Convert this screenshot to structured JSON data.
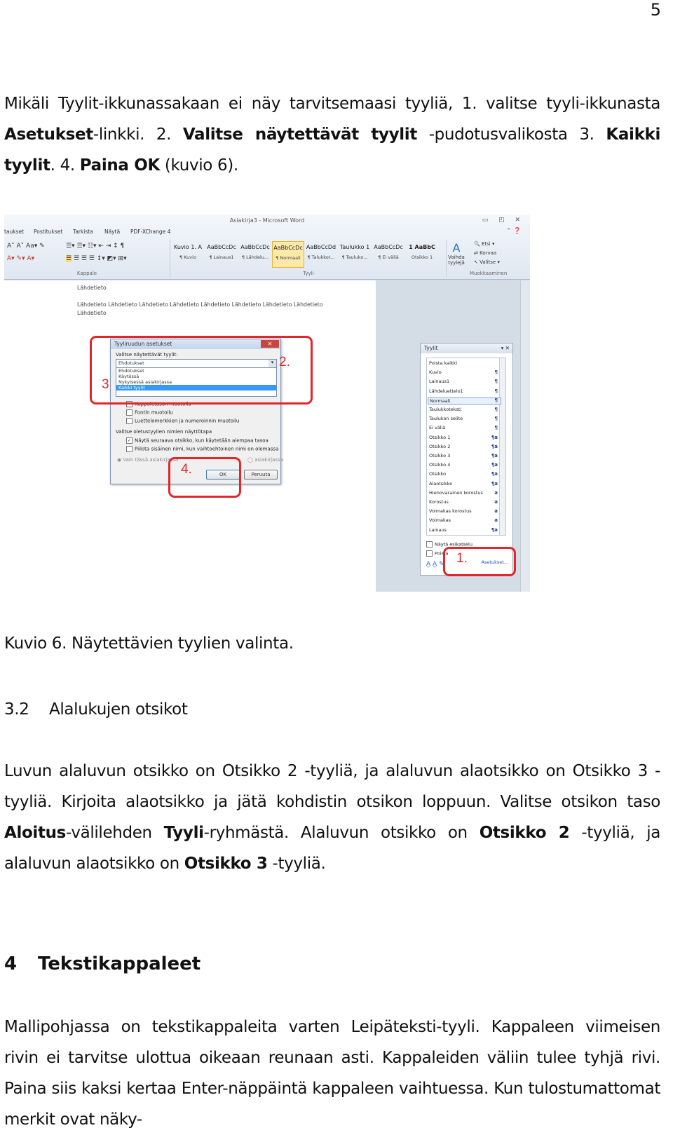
{
  "page_number": "5",
  "intro": {
    "t1": "Mikäli Tyylit-ikkunassakaan ei näy tarvitsemaasi tyyliä, 1. valitse tyyli-ikkunasta ",
    "b1": "Asetukset",
    "t2": "-linkki. 2. ",
    "b2": "Valitse näytettävät tyylit",
    "t3": " -pudotusvalikosta 3. ",
    "b3": "Kaikki tyylit",
    "t4": ". 4. ",
    "b4": "Paina OK",
    "t5": " (kuvio 6)."
  },
  "figure": {
    "window_title": "Asiakirja3 - Microsoft Word",
    "tabs": [
      "taukset",
      "Postitukset",
      "Tarkista",
      "Näytä",
      "PDF-XChange 4"
    ],
    "group_paragraph": "Kappale",
    "group_styles": "Tyyli",
    "group_editing": "Muokkaaminen",
    "style_gallery": [
      {
        "preview": "Kuvio 1. A",
        "name": "¶ Kuvio"
      },
      {
        "preview": "AaBbCcDc",
        "name": "¶ Lainaus1"
      },
      {
        "preview": "AaBbCcDc",
        "name": "¶ Lähdelu..."
      },
      {
        "preview": "AaBbCcDc",
        "name": "¶ Normaali"
      },
      {
        "preview": "AaBbCcDd",
        "name": "¶ Talukkot..."
      },
      {
        "preview": "Taulukko 1",
        "name": "¶ Taulukо..."
      },
      {
        "preview": "AaBbCcDc",
        "name": "¶ Ei väliä"
      },
      {
        "preview": "1 AaBbC",
        "name": "Otsikko 1"
      }
    ],
    "change_styles": "Vaihda tyylejä",
    "find": "Etsi",
    "replace": "Korvaa",
    "select": "Valitse",
    "doc_word": "Lähdetieto",
    "doc_line_1": "Lähdetieto Lähdetieto Lähdetieto Lähdetieto Lähdetieto Lähdetieto Lähdetieto Lähdetieto",
    "doc_line_2": "Lähdetieto",
    "dialog": {
      "title": "Tyyliruudun asetukset",
      "select_label": "Valitse näytettävät tyylit:",
      "combo_value": "Ehdotukset",
      "list": [
        "Ehdotukset",
        "Käytössä",
        "Nykyisessä asiakirjassa",
        "Kaikki tyylit"
      ],
      "opt_para": "Kappaletason muotoilu",
      "opt_font": "Fontin muotoilu",
      "opt_list": "Luettelomerkkien ja numeroinnin muotoilu",
      "names_label": "Valitse oletustyylien nimien näyttötapa",
      "opt_show_next": "Näytä seuraava otsikko, kun käytetään aiempaa tasoa",
      "opt_hide_builtin": "Piilota sisäinen nimi, kun vaihtoehtoinen nimi on olemassa",
      "radio_doc": "Vain tässä asiakirjassa",
      "radio_new": "asiakirjassa",
      "ok": "OK",
      "cancel": "Peruuta"
    },
    "pane": {
      "title": "Tyylit",
      "items": [
        {
          "name": "Poista kaikki",
          "mark": ""
        },
        {
          "name": "Kuvio",
          "mark": "¶"
        },
        {
          "name": "Lainaus1",
          "mark": "¶"
        },
        {
          "name": "Lähdeluettelo1",
          "mark": "¶"
        },
        {
          "name": "Normaali",
          "mark": "¶"
        },
        {
          "name": "Taulukkoteksti",
          "mark": "¶"
        },
        {
          "name": "Taulukon selite",
          "mark": "¶"
        },
        {
          "name": "Ei väliä",
          "mark": "¶"
        },
        {
          "name": "Otsikko 1",
          "mark": "¶a"
        },
        {
          "name": "Otsikko 2",
          "mark": "¶a"
        },
        {
          "name": "Otsikko 3",
          "mark": "¶a"
        },
        {
          "name": "Otsikko 4",
          "mark": "¶a"
        },
        {
          "name": "Otsikko",
          "mark": "¶a"
        },
        {
          "name": "Alaotsikko",
          "mark": "¶a"
        },
        {
          "name": "Hienovarainen korostus",
          "mark": "a"
        },
        {
          "name": "Korostus",
          "mark": "a"
        },
        {
          "name": "Voimakas korostus",
          "mark": "a"
        },
        {
          "name": "Voimakas",
          "mark": "a"
        },
        {
          "name": "Lainaus",
          "mark": "¶a"
        }
      ],
      "show_preview": "Näytä esikatselu",
      "disable_linked": "Poista",
      "settings_link": "Asetukset..."
    },
    "annotations": [
      "1.",
      "2.",
      "3",
      "4."
    ],
    "annotation_color": "#e1262c"
  },
  "caption": "Kuvio 6. Näytettävien tyylien valinta.",
  "section_3_2": {
    "number": "3.2",
    "title": "Alalukujen otsikot"
  },
  "para2": {
    "t1": "Luvun alaluvun otsikko on Otsikko 2 -tyyliä, ja alaluvun alaotsikko on Otsikko 3 -tyyliä. Kirjoita alaotsikko ja jätä kohdistin otsikon loppuun. Valitse otsikon taso ",
    "b1": "Aloitus",
    "t2": "-välilehden ",
    "b2": "Tyyli",
    "t3": "-ryhmästä. Alaluvun otsikko on ",
    "b3": "Otsikko 2",
    "t4": " -tyyliä, ja alaluvun alaotsik­ko on ",
    "b4": "Otsikko 3",
    "t5": " -tyyliä."
  },
  "section_4": {
    "number": "4",
    "title": "Tekstikappaleet"
  },
  "para3": {
    "t1": "Mallipohjassa on tekstikappaleita varten Leipäteksti-tyyli. Kappaleen viimeisen rivin ei tarvitse ulottua oikeaan reunaan asti. Kappaleiden väliin tulee tyhjä rivi. Paina siis kaksi kertaa Enter-näppäintä kappaleen vaihtuessa. Kun tulostumattomat merkit ovat näky-"
  }
}
